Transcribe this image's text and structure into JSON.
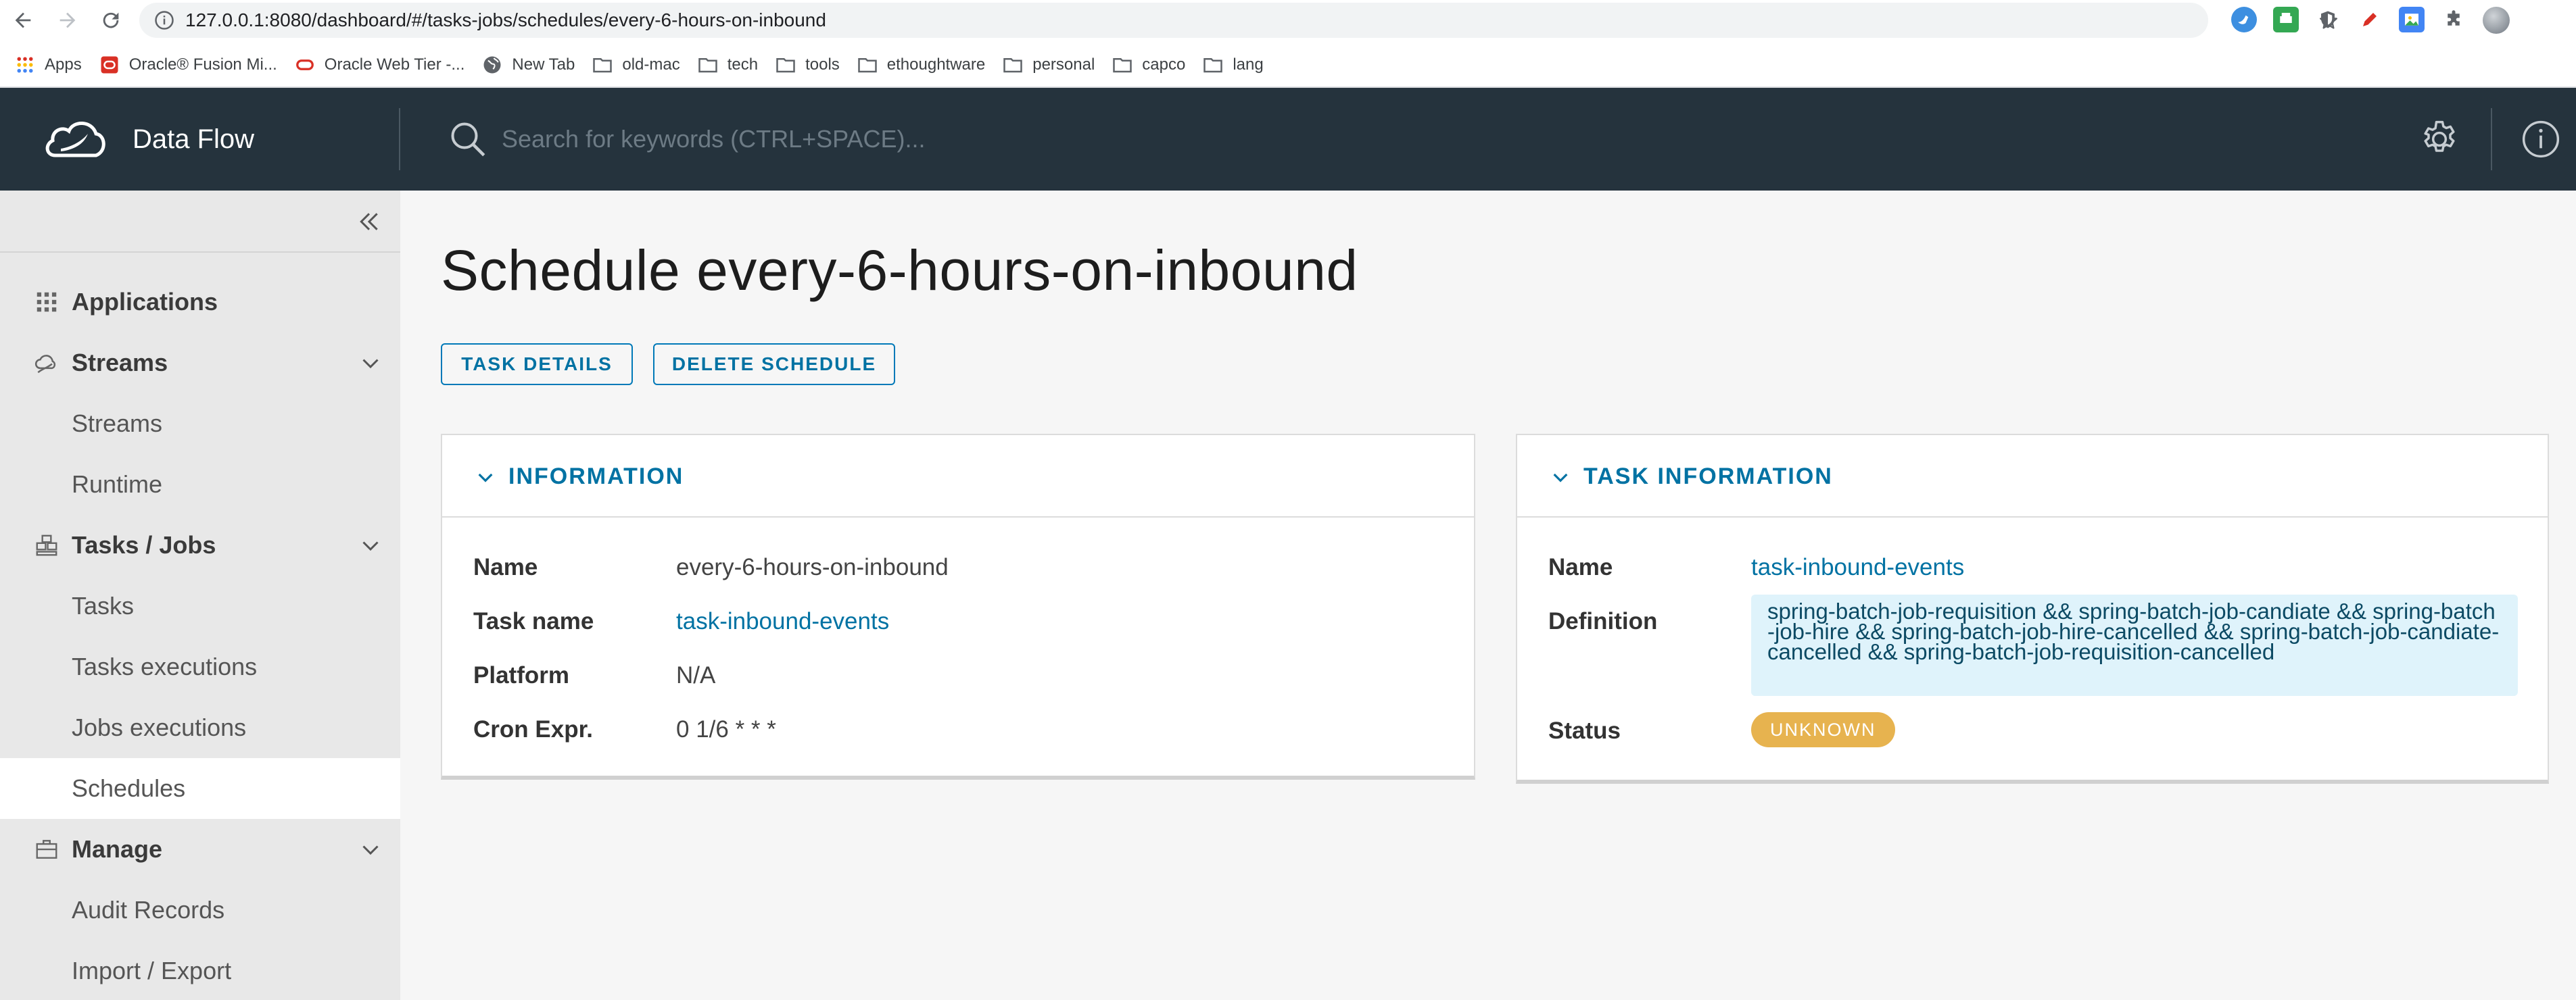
{
  "browser": {
    "url": "127.0.0.1:8080/dashboard/#/tasks-jobs/schedules/every-6-hours-on-inbound",
    "bookmarks": [
      {
        "label": "Apps",
        "icon": "apps-grid-icon"
      },
      {
        "label": "Oracle® Fusion Mi...",
        "icon": "oracle-icon"
      },
      {
        "label": "Oracle Web Tier -...",
        "icon": "oracle-ring-icon"
      },
      {
        "label": "New Tab",
        "icon": "globe-icon"
      },
      {
        "label": "old-mac",
        "icon": "folder-icon"
      },
      {
        "label": "tech",
        "icon": "folder-icon"
      },
      {
        "label": "tools",
        "icon": "folder-icon"
      },
      {
        "label": "ethoughtware",
        "icon": "folder-icon"
      },
      {
        "label": "personal",
        "icon": "folder-icon"
      },
      {
        "label": "capco",
        "icon": "folder-icon"
      },
      {
        "label": "lang",
        "icon": "folder-icon"
      }
    ]
  },
  "header": {
    "brand": "Data Flow",
    "search_placeholder": "Search for keywords (CTRL+SPACE)..."
  },
  "sidebar": {
    "items": [
      {
        "label": "Applications"
      },
      {
        "label": "Streams"
      },
      {
        "label": "Streams"
      },
      {
        "label": "Runtime"
      },
      {
        "label": "Tasks / Jobs"
      },
      {
        "label": "Tasks"
      },
      {
        "label": "Tasks executions"
      },
      {
        "label": "Jobs executions"
      },
      {
        "label": "Schedules"
      },
      {
        "label": "Manage"
      },
      {
        "label": "Audit Records"
      },
      {
        "label": "Import / Export"
      }
    ]
  },
  "main": {
    "title": "Schedule every-6-hours-on-inbound",
    "buttons": {
      "task_details": "TASK DETAILS",
      "delete_schedule": "DELETE SCHEDULE"
    },
    "information": {
      "title": "INFORMATION",
      "rows": [
        {
          "label": "Name",
          "value": "every-6-hours-on-inbound"
        },
        {
          "label": "Task name",
          "value": "task-inbound-events"
        },
        {
          "label": "Platform",
          "value": "N/A"
        },
        {
          "label": "Cron Expr.",
          "value": "0 1/6 * * *"
        }
      ]
    },
    "task_information": {
      "title": "TASK INFORMATION",
      "name_label": "Name",
      "name_value": "task-inbound-events",
      "definition_label": "Definition",
      "definition_value": "spring-batch-job-requisition && spring-batch-job-candiate && spring-batch-job-hire && spring-batch-job-hire-cancelled && spring-batch-job-candiate-cancelled && spring-batch-job-requisition-cancelled",
      "status_label": "Status",
      "status_value": "UNKNOWN"
    }
  },
  "colors": {
    "header_bg": "#25333d",
    "accent": "#0072a3",
    "badge_unknown": "#e7b34f",
    "definition_bg": "#dff3fb"
  }
}
